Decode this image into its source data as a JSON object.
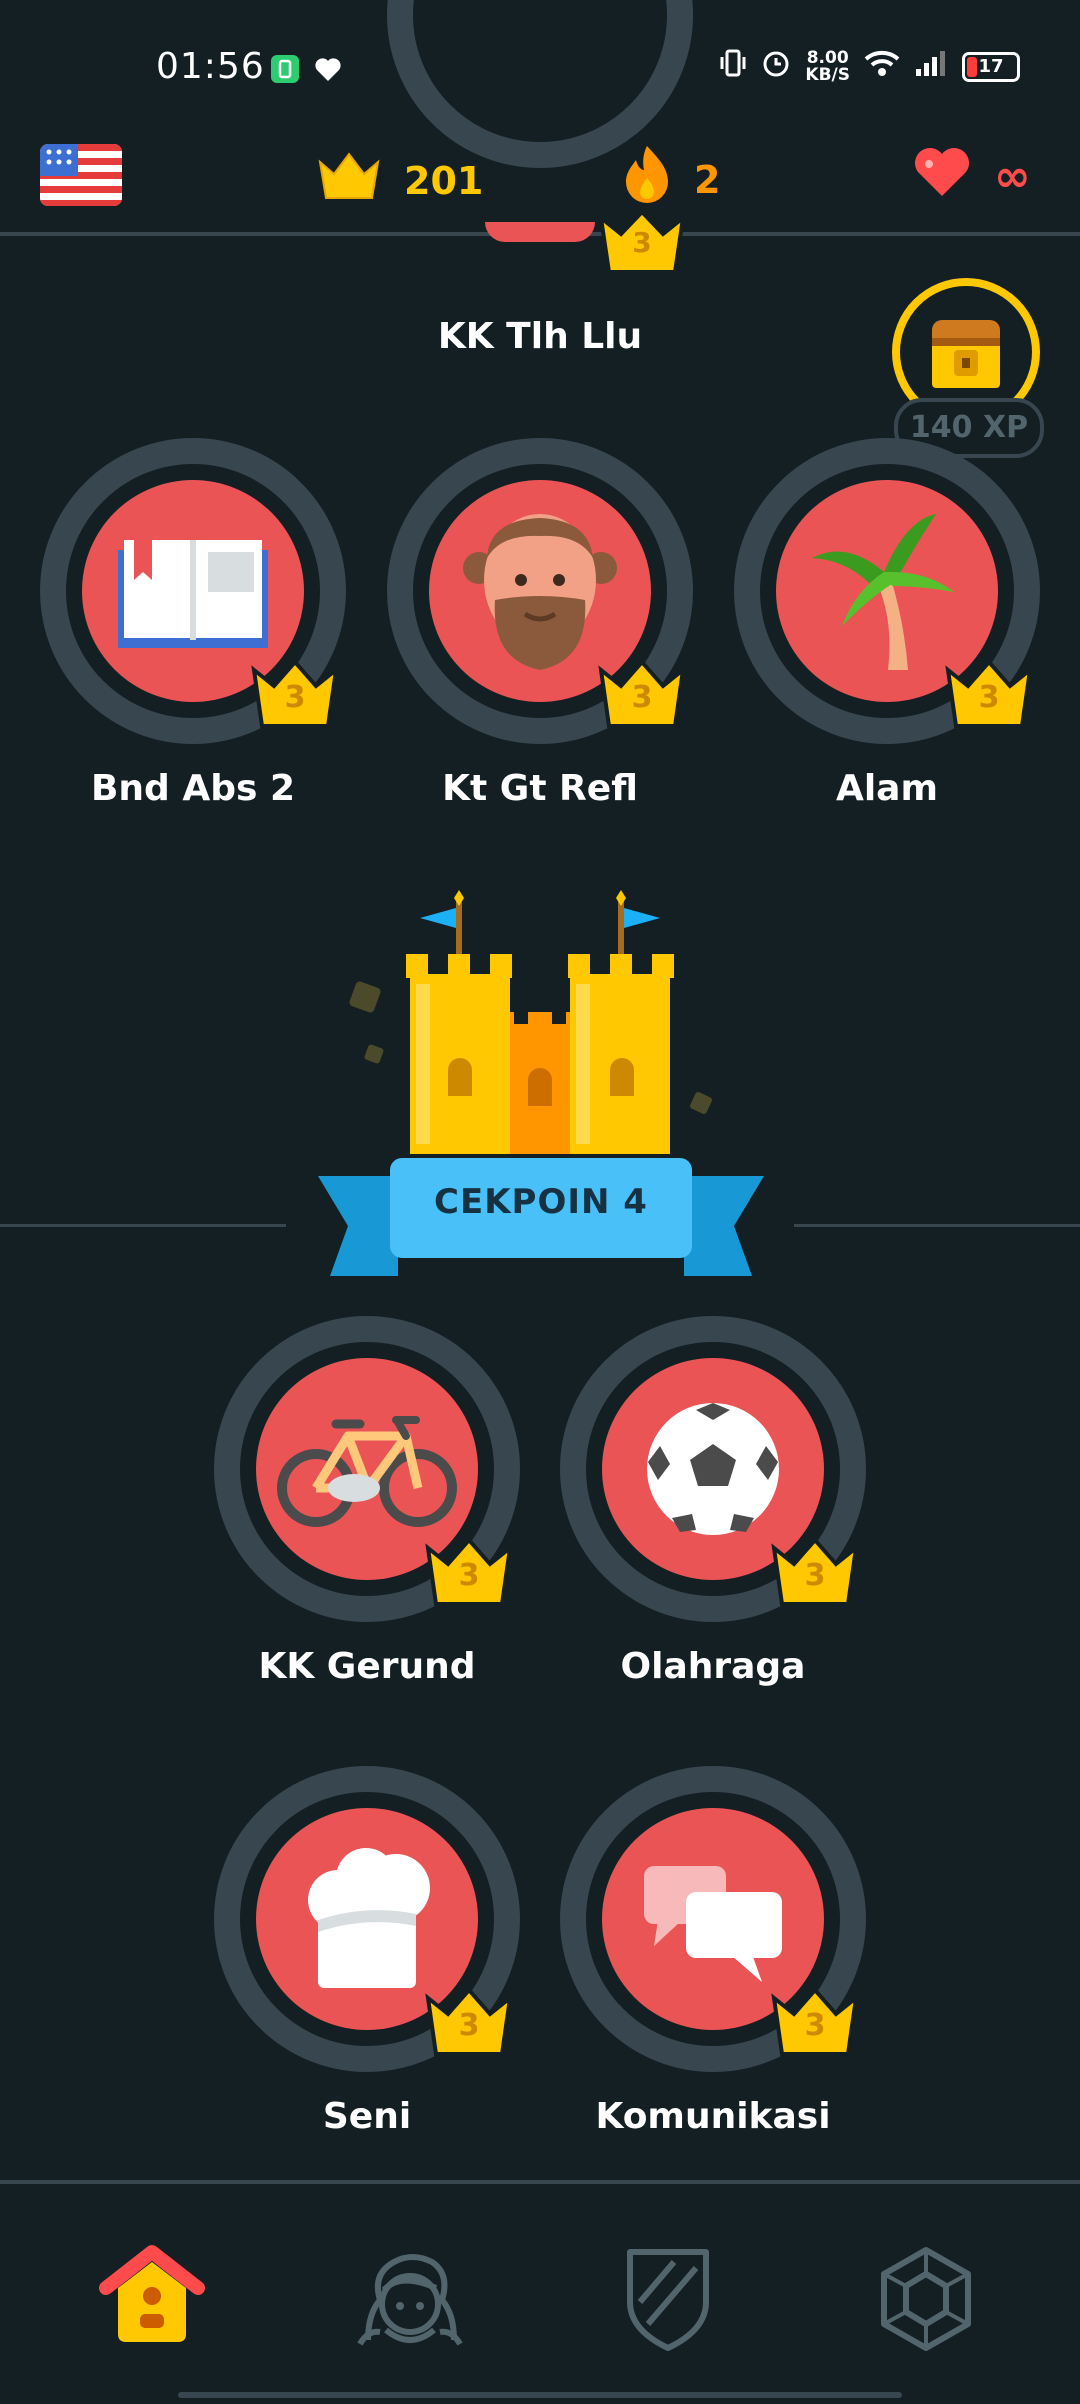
{
  "status_bar": {
    "time": "01:56",
    "net_speed_value": "8.00",
    "net_speed_unit": "KB/S",
    "battery": "17",
    "icons": [
      "battery-saver-icon",
      "heart-icon",
      "vibrate-icon",
      "alarm-icon",
      "wifi-icon",
      "signal-icon"
    ]
  },
  "top_bar": {
    "course_flag": "us-flag-icon",
    "crowns": "201",
    "streak": "2",
    "hearts": "∞"
  },
  "chest": {
    "xp_label": "140 XP"
  },
  "skills": {
    "kk_tlh_llu": {
      "name": "KK Tlh Llu",
      "level": "3"
    },
    "bnd_abs_2": {
      "name": "Bnd Abs 2",
      "level": "3"
    },
    "kt_gt_refl": {
      "name": "Kt Gt Refl",
      "level": "3"
    },
    "alam": {
      "name": "Alam",
      "level": "3"
    },
    "kk_gerund": {
      "name": "KK Gerund",
      "level": "3"
    },
    "olahraga": {
      "name": "Olahraga",
      "level": "3"
    },
    "seni": {
      "name": "Seni",
      "level": "3"
    },
    "komunikasi": {
      "name": "Komunikasi",
      "level": "3"
    }
  },
  "checkpoint": {
    "label": "CEKPOIN 4"
  },
  "bottom_nav": {
    "items": [
      "learn-home-icon",
      "profile-icon",
      "leagues-shield-icon",
      "shop-icon"
    ],
    "active": "learn-home-icon"
  },
  "colors": {
    "background": "#141f24",
    "skill_red": "#ea5455",
    "crown_gold": "#ffc800",
    "ring_gray": "#37464f",
    "checkpoint_blue": "#49c0f8"
  }
}
